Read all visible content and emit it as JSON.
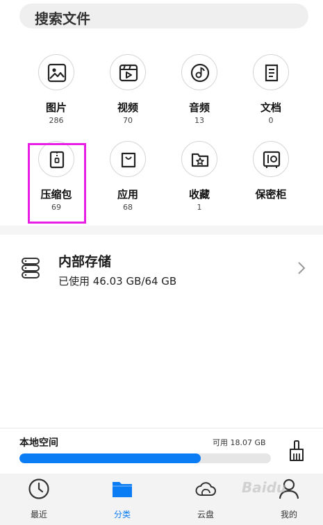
{
  "search": {
    "placeholder": "搜索文件"
  },
  "categories": [
    {
      "label": "图片",
      "count": "286",
      "icon": "image-icon"
    },
    {
      "label": "视频",
      "count": "70",
      "icon": "video-icon"
    },
    {
      "label": "音频",
      "count": "13",
      "icon": "audio-icon"
    },
    {
      "label": "文档",
      "count": "0",
      "icon": "document-icon"
    },
    {
      "label": "压缩包",
      "count": "69",
      "icon": "zip-icon"
    },
    {
      "label": "应用",
      "count": "68",
      "icon": "app-bag-icon"
    },
    {
      "label": "收藏",
      "count": "1",
      "icon": "favorite-folder-icon"
    },
    {
      "label": "保密柜",
      "count": "",
      "icon": "safe-icon"
    }
  ],
  "internal_storage": {
    "title": "内部存储",
    "used": "已使用 46.03 GB/64 GB",
    "used_fraction": 0.72
  },
  "local_space": {
    "title": "本地空间",
    "available": "可用 18.07 GB",
    "used_fraction": 0.72
  },
  "tabs": [
    {
      "label": "最近",
      "icon": "clock-icon"
    },
    {
      "label": "分类",
      "icon": "folder-icon"
    },
    {
      "label": "云盘",
      "icon": "cloud-icon"
    },
    {
      "label": "我的",
      "icon": "person-icon"
    }
  ],
  "colors": {
    "accent": "#0a7cf4",
    "highlight": "#e81ee5"
  },
  "watermark": "Baidu"
}
